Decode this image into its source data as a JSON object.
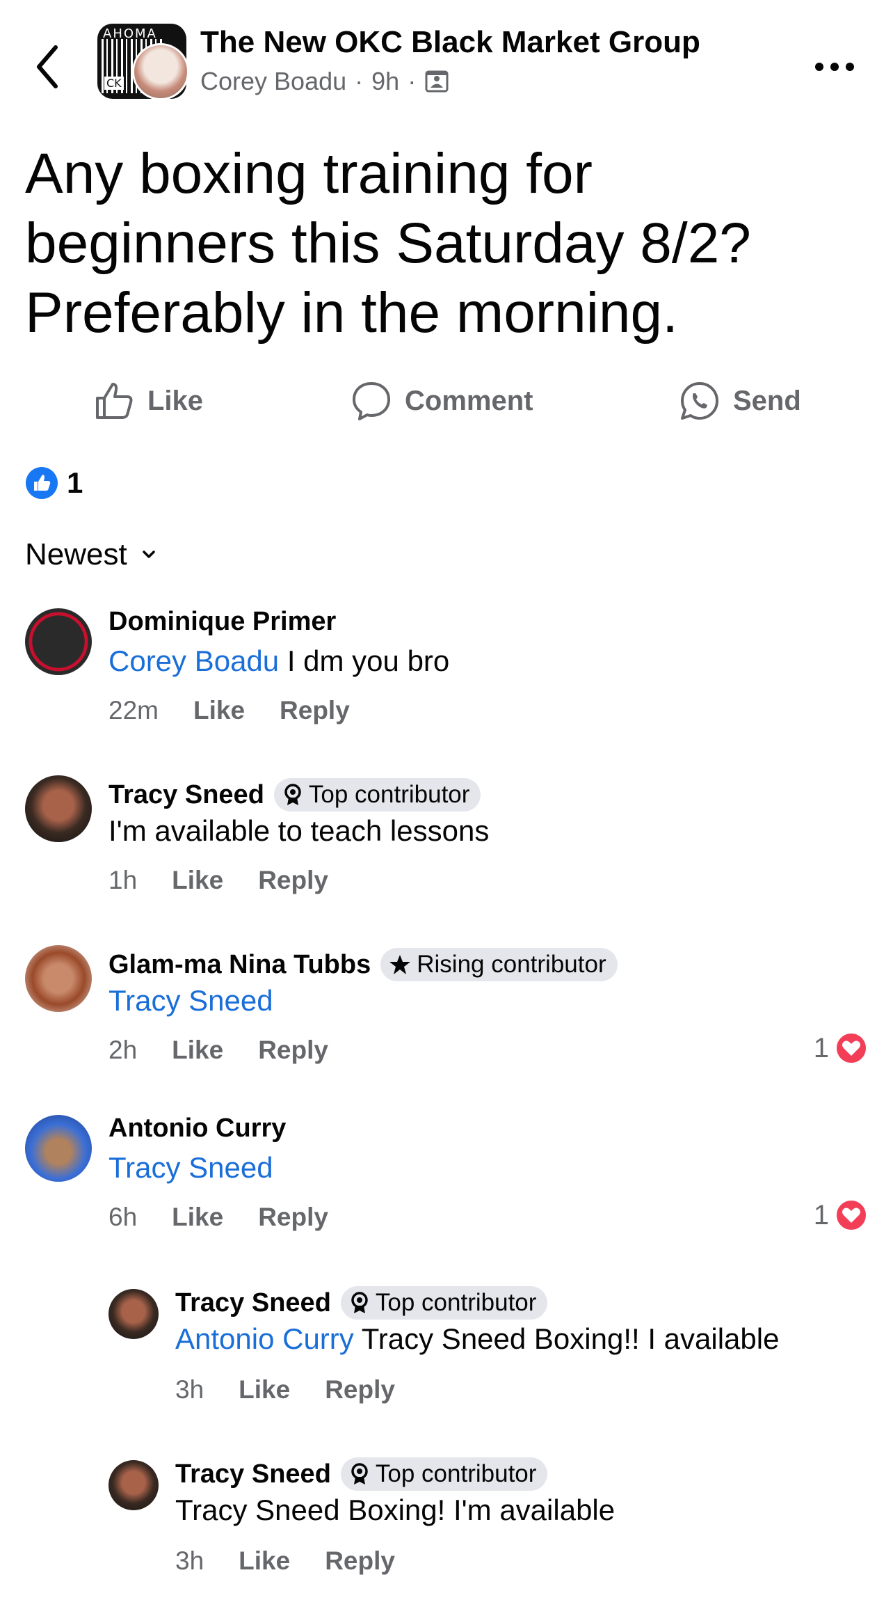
{
  "header": {
    "group_name": "The New OKC Black Market Group",
    "author": "Corey Boadu",
    "time": "9h",
    "avatar_text_top": "AHOMA",
    "avatar_text_bottom": "CK"
  },
  "post": {
    "line1": "Any boxing training for",
    "line2": "beginners this Saturday 8/2?",
    "line3": "Preferably in the morning."
  },
  "actions": {
    "like": "Like",
    "comment": "Comment",
    "send": "Send"
  },
  "reactions": {
    "count": "1",
    "icon": "thumbs-up",
    "color": "#1877f2"
  },
  "sort": {
    "label": "Newest"
  },
  "comments": [
    {
      "name": "Dominique Primer",
      "mention": "Corey Boadu",
      "text": " I dm you bro",
      "time": "22m",
      "like": "Like",
      "reply": "Reply"
    },
    {
      "name": "Tracy Sneed",
      "badge": "Top contributor",
      "text": "I'm available to teach lessons",
      "time": "1h",
      "like": "Like",
      "reply": "Reply"
    },
    {
      "name": "Glam-ma Nina Tubbs",
      "badge": "Rising contributor",
      "mention": "Tracy Sneed",
      "time": "2h",
      "like": "Like",
      "reply": "Reply",
      "reaction_count": "1"
    },
    {
      "name": "Antonio Curry",
      "mention": "Tracy Sneed",
      "time": "6h",
      "like": "Like",
      "reply": "Reply",
      "reaction_count": "1"
    },
    {
      "name": "Tracy Sneed",
      "badge": "Top contributor",
      "mention": "Antonio Curry",
      "text": " Tracy Sneed Boxing!! I available",
      "time": "3h",
      "like": "Like",
      "reply": "Reply"
    },
    {
      "name": "Tracy Sneed",
      "badge": "Top contributor",
      "text": "Tracy Sneed Boxing! I'm available",
      "time": "3h",
      "like": "Like",
      "reply": "Reply"
    }
  ],
  "colors": {
    "mention": "#1a6ed8",
    "secondary_text": "#65676b",
    "heart": "#f33e58"
  }
}
